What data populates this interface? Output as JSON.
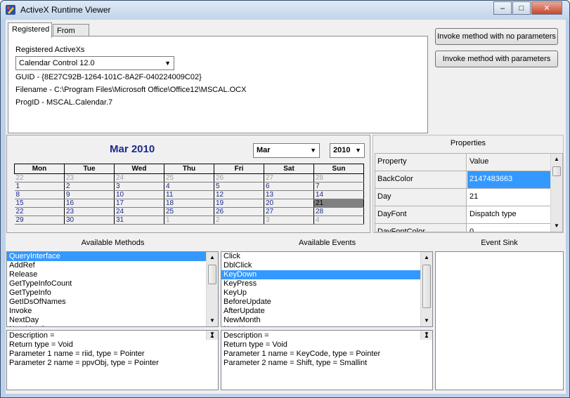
{
  "window": {
    "title": "ActiveX Runtime Viewer",
    "minimize": "–",
    "maximize": "□",
    "close": "✕"
  },
  "tabs": {
    "registered": "Registered",
    "from_file": "From File"
  },
  "registered": {
    "label": "Registered ActiveXs",
    "selected_control": "Calendar Control 12.0",
    "guid": "GUID - {8E27C92B-1264-101C-8A2F-040224009C02}",
    "filename": "Filename - C:\\Program Files\\Microsoft Office\\Office12\\MSCAL.OCX",
    "progid": "ProgID - MSCAL.Calendar.7"
  },
  "buttons": {
    "invoke_no_params": "Invoke method with no parameters",
    "invoke_params": "Invoke method with parameters"
  },
  "calendar": {
    "title": "Mar 2010",
    "month_value": "Mar",
    "year_value": "2010",
    "days": [
      "Mon",
      "Tue",
      "Wed",
      "Thu",
      "Fri",
      "Sat",
      "Sun"
    ],
    "weeks": [
      [
        {
          "d": "22",
          "g": true
        },
        {
          "d": "23",
          "g": true
        },
        {
          "d": "24",
          "g": true
        },
        {
          "d": "25",
          "g": true
        },
        {
          "d": "26",
          "g": true
        },
        {
          "d": "27",
          "g": true
        },
        {
          "d": "28",
          "g": true
        }
      ],
      [
        {
          "d": "1"
        },
        {
          "d": "2"
        },
        {
          "d": "3"
        },
        {
          "d": "4"
        },
        {
          "d": "5"
        },
        {
          "d": "6"
        },
        {
          "d": "7"
        }
      ],
      [
        {
          "d": "8"
        },
        {
          "d": "9"
        },
        {
          "d": "10"
        },
        {
          "d": "11"
        },
        {
          "d": "12"
        },
        {
          "d": "13"
        },
        {
          "d": "14"
        }
      ],
      [
        {
          "d": "15"
        },
        {
          "d": "16"
        },
        {
          "d": "17"
        },
        {
          "d": "18"
        },
        {
          "d": "19"
        },
        {
          "d": "20"
        },
        {
          "d": "21",
          "s": true
        }
      ],
      [
        {
          "d": "22"
        },
        {
          "d": "23"
        },
        {
          "d": "24"
        },
        {
          "d": "25"
        },
        {
          "d": "26"
        },
        {
          "d": "27"
        },
        {
          "d": "28"
        }
      ],
      [
        {
          "d": "29"
        },
        {
          "d": "30"
        },
        {
          "d": "31"
        },
        {
          "d": "1",
          "g": true
        },
        {
          "d": "2",
          "g": true
        },
        {
          "d": "3",
          "g": true
        },
        {
          "d": "4",
          "g": true
        }
      ]
    ]
  },
  "properties": {
    "header": "Properties",
    "col_property": "Property",
    "col_value": "Value",
    "rows": [
      {
        "name": "BackColor",
        "value": "2147483663"
      },
      {
        "name": "Day",
        "value": "21"
      },
      {
        "name": "DayFont",
        "value": "Dispatch type"
      },
      {
        "name": "DayFontColor",
        "value": "0"
      }
    ]
  },
  "methods": {
    "header": "Available Methods",
    "items": [
      "QueryInterface",
      "AddRef",
      "Release",
      "GetTypeInfoCount",
      "GetTypeInfo",
      "GetIDsOfNames",
      "Invoke",
      "NextDay",
      "NextMonth"
    ],
    "selected_index": 0,
    "description": [
      "Description =",
      "Return type = Void",
      "Parameter 1 name = riid, type = Pointer",
      "Parameter 2 name = ppvObj, type = Pointer"
    ]
  },
  "events": {
    "header": "Available Events",
    "items": [
      "Click",
      "DblClick",
      "KeyDown",
      "KeyPress",
      "KeyUp",
      "BeforeUpdate",
      "AfterUpdate",
      "NewMonth",
      "NewYear"
    ],
    "selected_index": 2,
    "description": [
      "Description =",
      "Return type = Void",
      "Parameter 1 name = KeyCode, type = Pointer",
      "Parameter 2 name = Shift, type = Smallint"
    ]
  },
  "event_sink": {
    "header": "Event Sink"
  }
}
